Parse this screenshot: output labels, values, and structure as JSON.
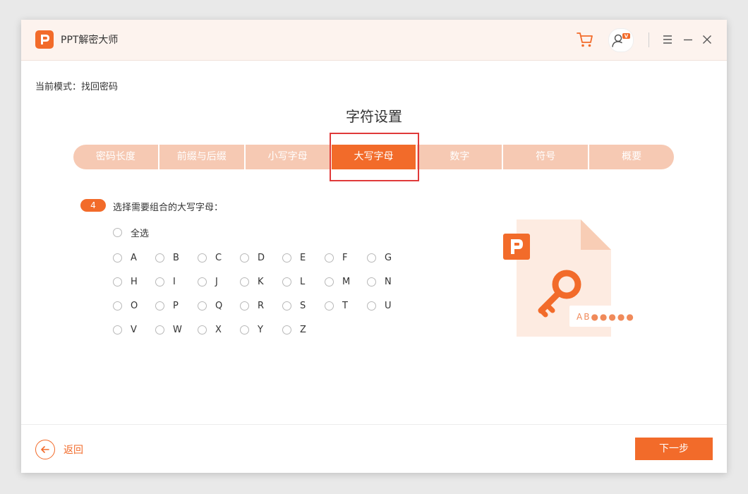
{
  "app": {
    "title": "PPT解密大师",
    "accent_color": "#f26b2a"
  },
  "titlebar": {
    "icons": [
      "cart-icon",
      "user-vip-icon",
      "menu-icon",
      "minimize-icon",
      "close-icon"
    ],
    "vip_badge": "V"
  },
  "mode": {
    "text": "当前模式：找回密码"
  },
  "section": {
    "title": "字符设置"
  },
  "steps": [
    {
      "label": "密码长度",
      "active": false
    },
    {
      "label": "前缀与后缀",
      "active": false
    },
    {
      "label": "小写字母",
      "active": false
    },
    {
      "label": "大写字母",
      "active": true
    },
    {
      "label": "数字",
      "active": false
    },
    {
      "label": "符号",
      "active": false
    },
    {
      "label": "概要",
      "active": false
    }
  ],
  "question": {
    "step_number": "4",
    "prompt": "选择需要组合的大写字母："
  },
  "options": {
    "select_all": "全选",
    "letters": [
      [
        "A",
        "B",
        "C",
        "D",
        "E",
        "F",
        "G"
      ],
      [
        "H",
        "I",
        "J",
        "K",
        "L",
        "M",
        "N"
      ],
      [
        "O",
        "P",
        "Q",
        "R",
        "S",
        "T",
        "U"
      ],
      [
        "V",
        "W",
        "X",
        "Y",
        "Z"
      ]
    ]
  },
  "illustration": {
    "password_hint": "AB●●●●●"
  },
  "footer": {
    "back_label": "返回",
    "next_label": "下一步"
  }
}
